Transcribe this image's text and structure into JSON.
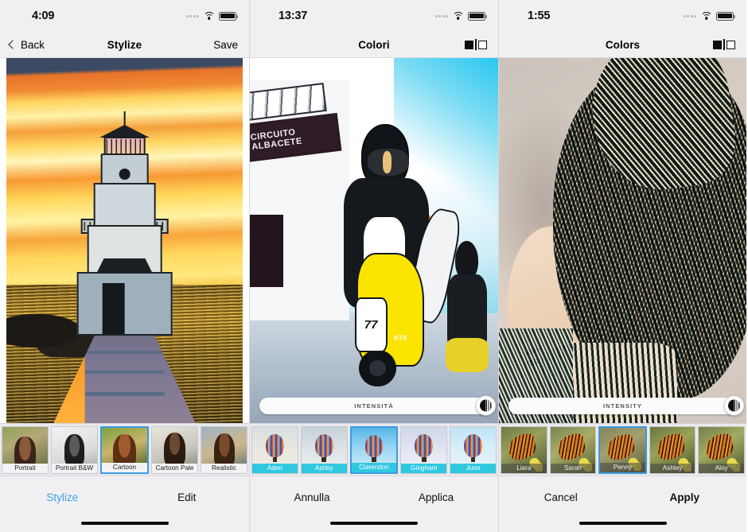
{
  "panels": [
    {
      "id": "stylize-en",
      "status": {
        "time": "4:09"
      },
      "nav": {
        "back_label": "Back",
        "title": "Stylize",
        "action_label": "Save"
      },
      "image": {
        "subject": "cartoon-stylized lighthouse at sunset with pier"
      },
      "slider": {
        "visible": false,
        "label": ""
      },
      "filters": [
        {
          "label": "Portrait",
          "selected": false
        },
        {
          "label": "Portrait B&W",
          "selected": false
        },
        {
          "label": "Cartoon",
          "selected": true
        },
        {
          "label": "Cartoon Pale",
          "selected": false
        },
        {
          "label": "Realistic",
          "selected": false
        }
      ],
      "bottom": {
        "left_label": "Stylize",
        "right_label": "Edit",
        "left_accent": true,
        "right_bold": false
      }
    },
    {
      "id": "colori-it",
      "status": {
        "time": "13:37"
      },
      "nav": {
        "back_label": "",
        "title": "Colori",
        "action_label": "compare-icon"
      },
      "image": {
        "subject": "comic-stylized motorcycle racer at Circuito Albacete",
        "sign_text": "CIRCUITO ALBACETE",
        "bike_number": "77",
        "bike_number2": "070"
      },
      "slider": {
        "visible": true,
        "label": "INTENSITÀ"
      },
      "filters": [
        {
          "label": "Aden",
          "selected": false
        },
        {
          "label": "Ashby",
          "selected": false
        },
        {
          "label": "Clarendon",
          "selected": true
        },
        {
          "label": "Gingham",
          "selected": false
        },
        {
          "label": "Juno",
          "selected": false
        }
      ],
      "bottom": {
        "left_label": "Annulla",
        "right_label": "Applica",
        "left_accent": false,
        "right_bold": false
      }
    },
    {
      "id": "colors-en",
      "status": {
        "time": "1:55"
      },
      "nav": {
        "back_label": "",
        "title": "Colors",
        "action_label": "compare-icon"
      },
      "image": {
        "subject": "sketch-stylized portrait of a person in profile"
      },
      "slider": {
        "visible": true,
        "label": "INTENSITY"
      },
      "filters": [
        {
          "label": "Liara",
          "selected": false
        },
        {
          "label": "Sarah",
          "selected": false
        },
        {
          "label": "Penny",
          "selected": true
        },
        {
          "label": "Ashley",
          "selected": false
        },
        {
          "label": "Aloy",
          "selected": false
        }
      ],
      "bottom": {
        "left_label": "Cancel",
        "right_label": "Apply",
        "left_accent": false,
        "right_bold": true
      }
    }
  ],
  "colors": {
    "accent_blue": "#3d9ee8",
    "selection_border": "#3b9ae1",
    "caption_cyan": "#30c8e0",
    "chrome_bg": "#f0f0f3"
  }
}
